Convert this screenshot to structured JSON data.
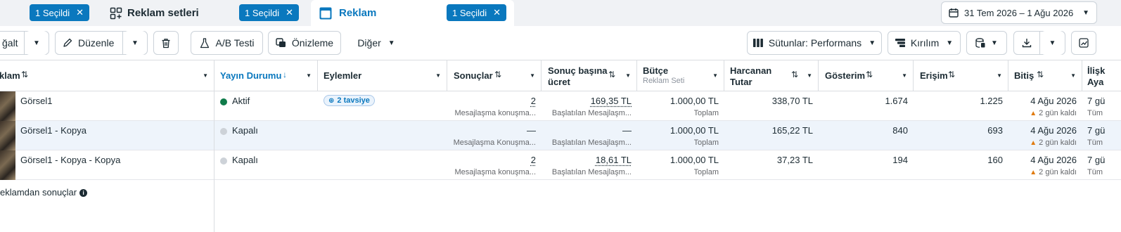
{
  "tabs": {
    "campaign_chip": "1 Seçildi",
    "adset_title": "Reklam setleri",
    "adset_chip": "1 Seçildi",
    "ad_title": "Reklam",
    "ad_chip": "1 Seçildi"
  },
  "date_range": "31 Tem 2026 – 1 Ağu 2026",
  "toolbar": {
    "duplicate_partial": "ğalt",
    "edit": "Düzenle",
    "ab_test": "A/B Testi",
    "preview": "Önizleme",
    "more": "Diğer",
    "columns": "Sütunlar: Performans",
    "breakdown": "Kırılım"
  },
  "columns": {
    "ad": "klam",
    "status": "Yayın Durumu",
    "actions": "Eylemler",
    "results": "Sonuçlar",
    "cost_per_result_1": "Sonuç başına",
    "cost_per_result_2": "ücret",
    "budget": "Bütçe",
    "budget_sub": "Reklam Seti",
    "spent_1": "Harcanan",
    "spent_2": "Tutar",
    "impressions": "Gösterim",
    "reach": "Erişim",
    "end": "Bitiş",
    "attr_1": "İlişk",
    "attr_2": "Aya"
  },
  "rows": [
    {
      "name": "Görsel1",
      "status": "Aktif",
      "status_color": "#0f7b4a",
      "actions_badge": "2 tavsiye",
      "results": "2",
      "results_sub": "Mesajlaşma konuşma...",
      "cpr": "169,35 TL",
      "cpr_sub": "Başlatılan Mesajlaşm...",
      "budget": "1.000,00 TL",
      "budget_sub": "Toplam",
      "spent": "338,70 TL",
      "impressions": "1.674",
      "reach": "1.225",
      "end": "4 Ağu 2026",
      "end_sub": "2 gün kaldı",
      "attr": "7 gü",
      "attr_sub": "Tüm"
    },
    {
      "name": "Görsel1 - Kopya",
      "status": "Kapalı",
      "status_color": "#cdd2d8",
      "actions_badge": "",
      "results": "—",
      "results_sub": "Mesajlaşma Konuşma...",
      "cpr": "—",
      "cpr_sub": "Başlatılan Mesajlaşm...",
      "budget": "1.000,00 TL",
      "budget_sub": "Toplam",
      "spent": "165,22 TL",
      "impressions": "840",
      "reach": "693",
      "end": "4 Ağu 2026",
      "end_sub": "2 gün kaldı",
      "attr": "7 gü",
      "attr_sub": "Tüm"
    },
    {
      "name": "Görsel1 - Kopya - Kopya",
      "status": "Kapalı",
      "status_color": "#cdd2d8",
      "actions_badge": "",
      "results": "2",
      "results_sub": "Mesajlaşma konuşma...",
      "cpr": "18,61 TL",
      "cpr_sub": "Başlatılan Mesajlaşm...",
      "budget": "1.000,00 TL",
      "budget_sub": "Toplam",
      "spent": "37,23 TL",
      "impressions": "194",
      "reach": "160",
      "end": "4 Ağu 2026",
      "end_sub": "2 gün kaldı",
      "attr": "7 gü",
      "attr_sub": "Tüm"
    }
  ],
  "footer": {
    "results_from_ads": "eklamdan sonuçlar"
  },
  "icons": {
    "close": "close-icon",
    "grid": "grid-icon",
    "calendar": "calendar-icon",
    "pencil": "pencil-icon",
    "trash": "trash-icon",
    "flask": "flask-icon",
    "preview": "preview-icon",
    "columns": "columns-icon",
    "breakdown": "breakdown-icon",
    "reports": "reports-icon",
    "download": "download-icon",
    "chart": "chart-icon",
    "info": "info-icon",
    "warning": "warning-icon"
  },
  "colors": {
    "accent": "#0a78be",
    "active": "#0f7b4a",
    "inactive": "#cdd2d8",
    "warning": "#e07a0e"
  }
}
